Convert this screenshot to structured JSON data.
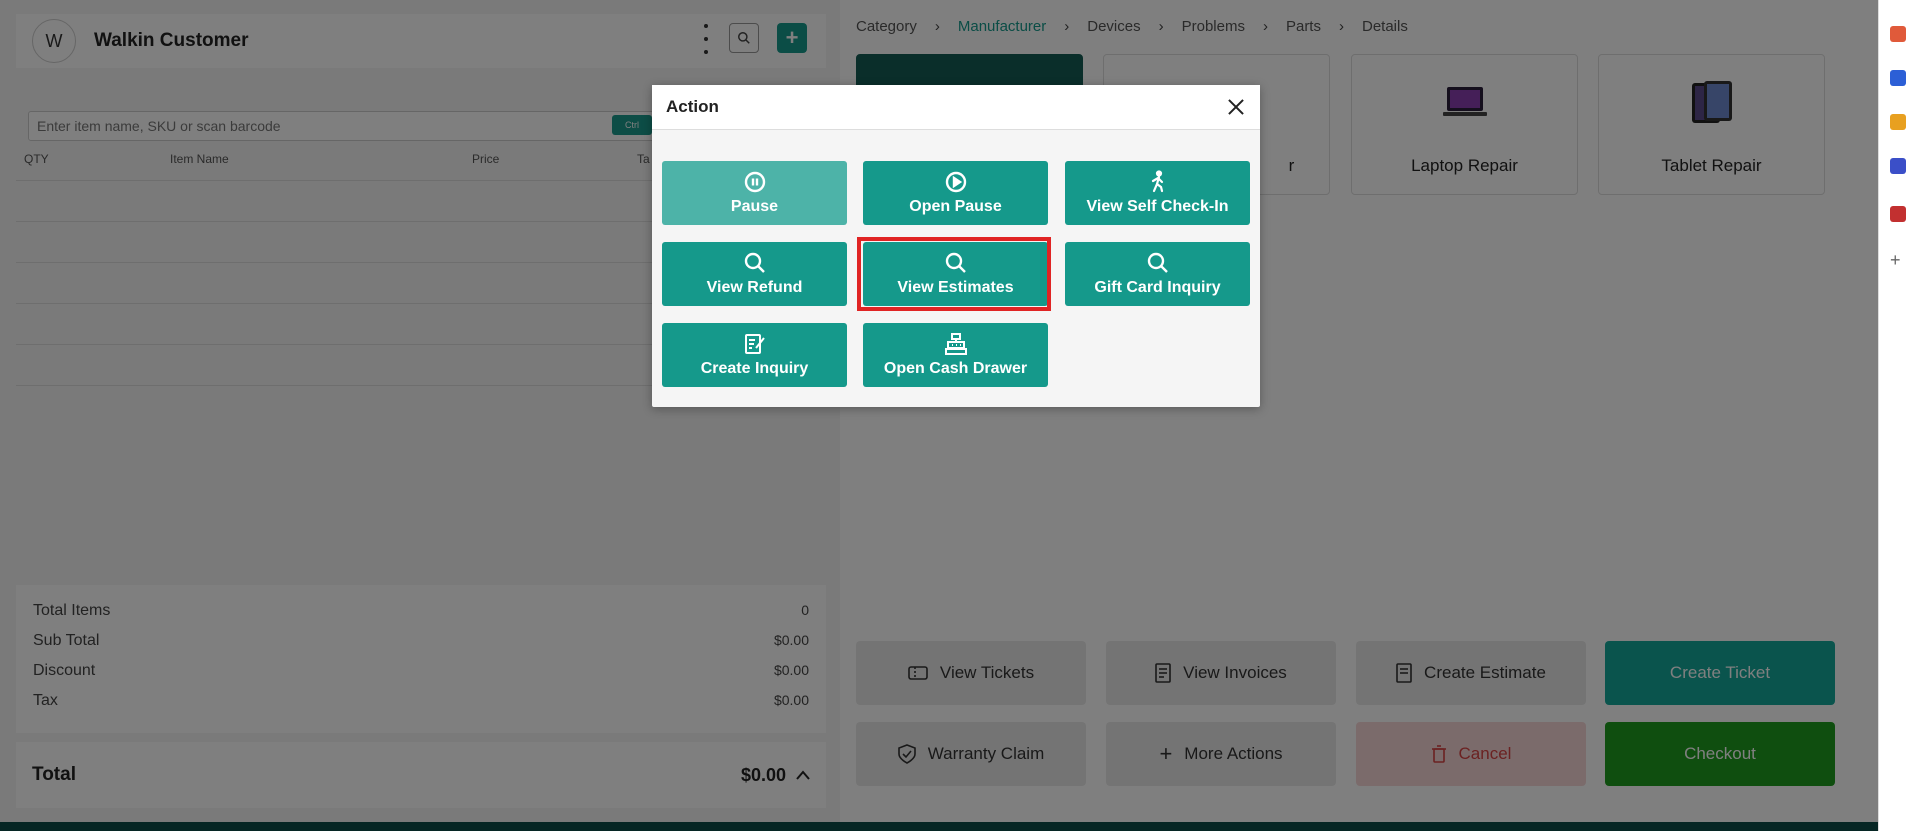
{
  "customer": {
    "initial": "W",
    "name": "Walkin Customer"
  },
  "item_search": {
    "placeholder": "Enter item name, SKU or scan barcode",
    "shortcut": "Ctrl"
  },
  "cart_columns": [
    "QTY",
    "Item Name",
    "Price",
    "Ta"
  ],
  "summary": {
    "rows": [
      {
        "label": "Total Items",
        "value": "0"
      },
      {
        "label": "Sub Total",
        "value": "$0.00"
      },
      {
        "label": "Discount",
        "value": "$0.00"
      },
      {
        "label": "Tax",
        "value": "$0.00"
      }
    ],
    "total_label": "Total",
    "total_value": "$0.00"
  },
  "breadcrumb": [
    "Category",
    "Manufacturer",
    "Devices",
    "Problems",
    "Parts",
    "Details"
  ],
  "tiles": [
    {
      "label": ""
    },
    {
      "label": "r"
    },
    {
      "label": "Laptop Repair"
    },
    {
      "label": "Tablet Repair"
    }
  ],
  "bottom_actions": {
    "view_tickets": "View Tickets",
    "view_invoices": "View Invoices",
    "create_estimate": "Create Estimate",
    "create_ticket": "Create Ticket",
    "warranty_claim": "Warranty Claim",
    "more_actions": "More Actions",
    "cancel": "Cancel",
    "checkout": "Checkout"
  },
  "modal": {
    "title": "Action",
    "buttons": {
      "pause": "Pause",
      "open_pause": "Open Pause",
      "view_self_checkin": "View Self Check-In",
      "view_refund": "View Refund",
      "view_estimates": "View Estimates",
      "gift_card_inquiry": "Gift Card Inquiry",
      "create_inquiry": "Create Inquiry",
      "open_cash_drawer": "Open Cash Drawer"
    }
  },
  "colors": {
    "accent": "#15998b",
    "highlight": "#e02424",
    "checkout": "#1f9d1f",
    "cancel": "#d64545"
  }
}
